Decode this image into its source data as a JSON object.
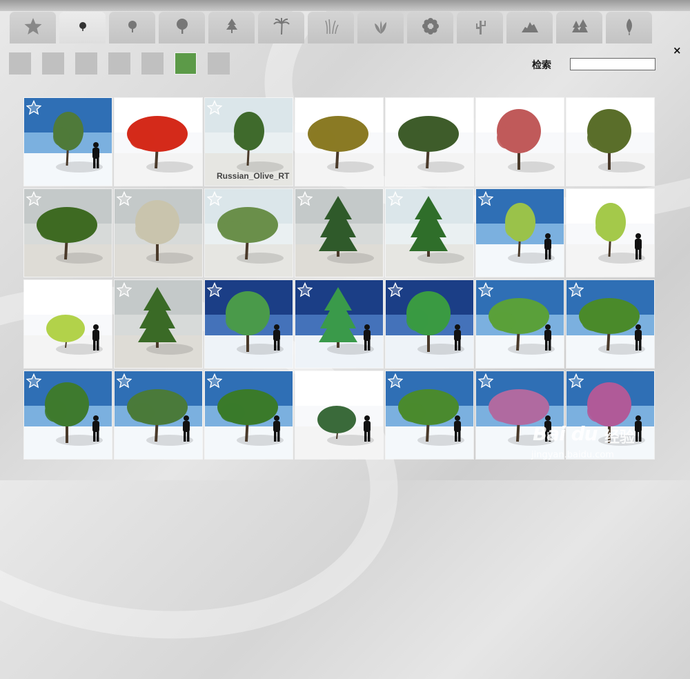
{
  "app_title": "",
  "tabs": [
    {
      "icon": "star-icon",
      "active": false
    },
    {
      "icon": "small-tree-icon",
      "active": true
    },
    {
      "icon": "round-tree-icon",
      "active": false
    },
    {
      "icon": "large-tree-icon",
      "active": false
    },
    {
      "icon": "conifer-icon",
      "active": false
    },
    {
      "icon": "palm-icon",
      "active": false
    },
    {
      "icon": "grass-icon",
      "active": false
    },
    {
      "icon": "shrub-icon",
      "active": false
    },
    {
      "icon": "flower-icon",
      "active": false
    },
    {
      "icon": "cactus-icon",
      "active": false
    },
    {
      "icon": "rock-icon",
      "active": false
    },
    {
      "icon": "forest-icon",
      "active": false
    },
    {
      "icon": "leaf-icon",
      "active": false
    }
  ],
  "swatches": [
    {
      "color": "#c0c0c0",
      "selected": false
    },
    {
      "color": "#c0c0c0",
      "selected": false
    },
    {
      "color": "#c0c0c0",
      "selected": false
    },
    {
      "color": "#c0c0c0",
      "selected": false
    },
    {
      "color": "#c0c0c0",
      "selected": false
    },
    {
      "color": "#5c9a48",
      "selected": true
    },
    {
      "color": "#c0c0c0",
      "selected": false
    }
  ],
  "search": {
    "label": "检索",
    "value": ""
  },
  "close_label": "×",
  "tree_tiles": [
    {
      "label": "",
      "bg": "blue",
      "foliage": "#4f7a3a",
      "shape": "thin",
      "person": true
    },
    {
      "label": "",
      "bg": "white",
      "foliage": "#d42a1a",
      "shape": "wide",
      "person": false
    },
    {
      "label": "Russian_Olive_RT",
      "bg": "pale",
      "foliage": "#3f6a2c",
      "shape": "thin",
      "person": false
    },
    {
      "label": "",
      "bg": "white",
      "foliage": "#8a7a24",
      "shape": "wide",
      "person": false
    },
    {
      "label": "",
      "bg": "white",
      "foliage": "#3e5c2a",
      "shape": "wide",
      "person": false
    },
    {
      "label": "",
      "bg": "white",
      "foliage": "#c05a5a",
      "shape": "round",
      "person": false
    },
    {
      "label": "",
      "bg": "white",
      "foliage": "#5a6e2a",
      "shape": "round",
      "person": false
    },
    {
      "label": "",
      "bg": "grey",
      "foliage": "#3e6a22",
      "shape": "wide",
      "person": false
    },
    {
      "label": "",
      "bg": "grey",
      "foliage": "#c9c4ad",
      "shape": "round",
      "person": false
    },
    {
      "label": "",
      "bg": "pale",
      "foliage": "#6a8f4a",
      "shape": "wide",
      "person": false
    },
    {
      "label": "",
      "bg": "grey",
      "foliage": "#2f5a2a",
      "shape": "conifer",
      "person": false
    },
    {
      "label": "",
      "bg": "pale",
      "foliage": "#2f6e2a",
      "shape": "conifer",
      "person": false
    },
    {
      "label": "",
      "bg": "blue",
      "foliage": "#9ac24a",
      "shape": "thin",
      "person": true
    },
    {
      "label": "",
      "bg": "white",
      "foliage": "#a4c94a",
      "shape": "thin",
      "person": true
    },
    {
      "label": "",
      "bg": "white",
      "foliage": "#b2d24a",
      "shape": "bush",
      "person": true
    },
    {
      "label": "",
      "bg": "grey",
      "foliage": "#3a6a26",
      "shape": "conifer",
      "person": false
    },
    {
      "label": "",
      "bg": "darkblue",
      "foliage": "#4a9a4a",
      "shape": "round",
      "person": true
    },
    {
      "label": "",
      "bg": "darkblue",
      "foliage": "#3a9a4a",
      "shape": "conifer",
      "person": true
    },
    {
      "label": "",
      "bg": "darkblue",
      "foliage": "#3a9a42",
      "shape": "round",
      "person": true
    },
    {
      "label": "",
      "bg": "blue",
      "foliage": "#5aa03a",
      "shape": "wide",
      "person": true
    },
    {
      "label": "",
      "bg": "blue",
      "foliage": "#4a8a2a",
      "shape": "wide",
      "person": true
    },
    {
      "label": "",
      "bg": "blue",
      "foliage": "#3e7a2e",
      "shape": "round",
      "person": true
    },
    {
      "label": "",
      "bg": "blue",
      "foliage": "#4a7a3a",
      "shape": "wide",
      "person": true
    },
    {
      "label": "",
      "bg": "blue",
      "foliage": "#3a7a2a",
      "shape": "wide",
      "person": true
    },
    {
      "label": "",
      "bg": "white",
      "foliage": "#3a6a3a",
      "shape": "bush",
      "person": true
    },
    {
      "label": "",
      "bg": "blue",
      "foliage": "#4a8a2e",
      "shape": "wide",
      "person": true
    },
    {
      "label": "",
      "bg": "blue",
      "foliage": "#b06aa0",
      "shape": "wide",
      "person": true
    },
    {
      "label": "",
      "bg": "blue",
      "foliage": "#b05a98",
      "shape": "round",
      "person": true
    }
  ],
  "watermark": {
    "brand": "Bai du",
    "cn": "经验",
    "url": "jingyan.baidu.com"
  }
}
